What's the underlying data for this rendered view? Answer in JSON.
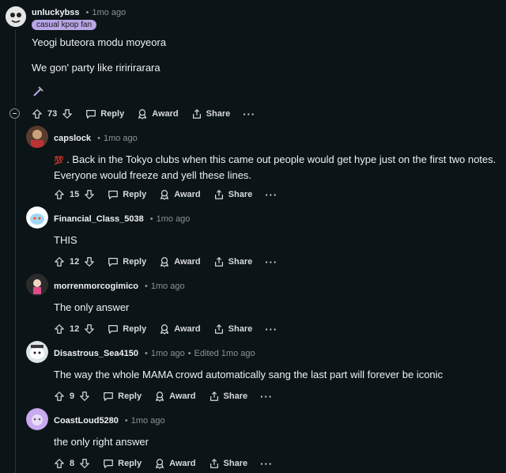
{
  "comments": [
    {
      "user": "unluckybss",
      "time": "1mo ago",
      "flair": "casual kpop fan",
      "body": [
        "Yeogi buteora modu moyeora",
        "We gon' party like riririrarara"
      ],
      "votes": "73"
    },
    {
      "user": "capslock",
      "time": "1mo ago",
      "emoji": "💯",
      "body": [
        ". Back in the Tokyo clubs when this came out people would get hype just on the first two notes.",
        "Everyone would freeze and yell these lines."
      ],
      "votes": "15"
    },
    {
      "user": "Financial_Class_5038",
      "time": "1mo ago",
      "body": [
        "THIS"
      ],
      "votes": "12"
    },
    {
      "user": "morrenmorcogimico",
      "time": "1mo ago",
      "body": [
        "The only answer"
      ],
      "votes": "12"
    },
    {
      "user": "Disastrous_Sea4150",
      "time": "1mo ago",
      "edited": "Edited 1mo ago",
      "body": [
        "The way the whole MAMA crowd automatically sang the last part will forever be iconic"
      ],
      "votes": "9"
    },
    {
      "user": "CoastLoud5280",
      "time": "1mo ago",
      "body": [
        "the only right answer"
      ],
      "votes": "8"
    }
  ],
  "labels": {
    "reply": "Reply",
    "award": "Award",
    "share": "Share",
    "more": "···",
    "dot": "•"
  },
  "colors": {
    "background": "#0b1416",
    "flair": "#b8a6e6",
    "text": "#eef1f3",
    "meta": "#8a9499"
  },
  "icons": [
    "upvote-icon",
    "downvote-icon",
    "reply-icon",
    "award-icon",
    "share-icon",
    "more-icon",
    "collapse-icon",
    "pickaxe-icon"
  ]
}
